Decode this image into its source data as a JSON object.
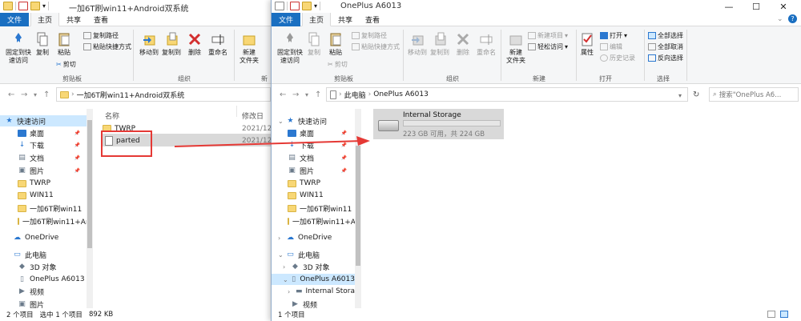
{
  "left": {
    "title": "一加6T刷win11+Android双系统",
    "tabs": [
      "文件",
      "主页",
      "共享",
      "查看"
    ],
    "ribbon": {
      "pin": "固定到快\n速访问",
      "copy": "复制",
      "paste": "粘贴",
      "copy_path": "复制路径",
      "paste_shortcut": "粘贴快捷方式",
      "cut": "剪切",
      "clipboard_group": "剪贴板",
      "move_to": "移动到",
      "copy_to": "复制到",
      "delete": "删除",
      "rename": "重命名",
      "organize_group": "组织",
      "new_folder": "新建\n文件夹",
      "new_group": "新"
    },
    "address": "一加6T刷win11+Android双系统",
    "nav": [
      {
        "label": "快速访问",
        "kind": "star",
        "sel": true
      },
      {
        "label": "桌面",
        "kind": "blue",
        "pin": true
      },
      {
        "label": "下载",
        "kind": "down",
        "pin": true
      },
      {
        "label": "文档",
        "kind": "doc",
        "pin": true
      },
      {
        "label": "图片",
        "kind": "pic",
        "pin": true
      },
      {
        "label": "TWRP",
        "kind": "folder"
      },
      {
        "label": "WIN11",
        "kind": "folder"
      },
      {
        "label": "一加6T刷win11",
        "kind": "folder"
      },
      {
        "label": "一加6T刷win11+An",
        "kind": "folder"
      },
      {
        "label": "OneDrive",
        "kind": "cloud"
      },
      {
        "label": "此电脑",
        "kind": "pc"
      },
      {
        "label": "3D 对象",
        "kind": "obj"
      },
      {
        "label": "OnePlus A6013",
        "kind": "phone"
      },
      {
        "label": "视频",
        "kind": "vid"
      },
      {
        "label": "图片",
        "kind": "pic"
      }
    ],
    "columns": {
      "name": "名称",
      "modified": "修改日"
    },
    "files": [
      {
        "name": "TWRP",
        "date": "2021/12/",
        "kind": "folder"
      },
      {
        "name": "parted",
        "date": "2021/12/",
        "kind": "file"
      }
    ],
    "status": {
      "count": "2 个项目",
      "selected": "选中 1 个项目",
      "size": "892 KB"
    }
  },
  "right": {
    "title": "OnePlus A6013",
    "tabs": [
      "文件",
      "主页",
      "共享",
      "查看"
    ],
    "ribbon": {
      "pin": "固定到快\n速访问",
      "copy": "复制",
      "paste": "粘贴",
      "copy_path": "复制路径",
      "paste_shortcut": "粘贴快捷方式",
      "cut": "剪切",
      "clipboard_group": "剪贴板",
      "move_to": "移动到",
      "copy_to": "复制到",
      "delete": "删除",
      "rename": "重命名",
      "organize_group": "组织",
      "new_item": "新建项目",
      "easy_access": "轻松访问",
      "new_folder": "新建\n文件夹",
      "new_group": "新建",
      "properties": "属性",
      "open": "打开",
      "edit": "编辑",
      "history": "历史记录",
      "open_group": "打开",
      "select_all": "全部选择",
      "select_none": "全部取消",
      "invert": "反向选择",
      "select_group": "选择"
    },
    "address": [
      "此电脑",
      "OnePlus A6013"
    ],
    "search_placeholder": "搜索\"OnePlus A6...",
    "nav": [
      {
        "label": "快速访问",
        "kind": "star"
      },
      {
        "label": "桌面",
        "kind": "blue",
        "pin": true
      },
      {
        "label": "下载",
        "kind": "down",
        "pin": true
      },
      {
        "label": "文档",
        "kind": "doc",
        "pin": true
      },
      {
        "label": "图片",
        "kind": "pic",
        "pin": true
      },
      {
        "label": "TWRP",
        "kind": "folder"
      },
      {
        "label": "WIN11",
        "kind": "folder"
      },
      {
        "label": "一加6T刷win11",
        "kind": "folder"
      },
      {
        "label": "一加6T刷win11+An",
        "kind": "folder"
      },
      {
        "label": "OneDrive",
        "kind": "cloud"
      },
      {
        "label": "此电脑",
        "kind": "pc"
      },
      {
        "label": "3D 对象",
        "kind": "obj"
      },
      {
        "label": "OnePlus A6013",
        "kind": "phone",
        "sel": true
      },
      {
        "label": "Internal Storage",
        "kind": "drive"
      },
      {
        "label": "视频",
        "kind": "vid"
      }
    ],
    "drive": {
      "name": "Internal Storage",
      "info": "223 GB 可用，共 224 GB",
      "used_fraction": 0.005
    },
    "status": {
      "count": "1 个项目"
    }
  },
  "colors": {
    "accent": "#1a6fc1",
    "selection": "#cce8ff",
    "annotation": "#e53935"
  }
}
